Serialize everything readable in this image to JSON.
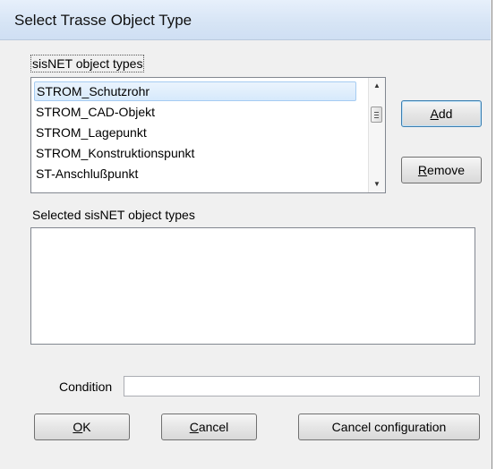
{
  "window": {
    "title": "Select Trasse Object Type"
  },
  "object_types": {
    "label": "sisNET object types",
    "items": [
      "STROM_Schutzrohr",
      "STROM_CAD-Objekt",
      "STROM_Lagepunkt",
      "STROM_Konstruktionspunkt",
      "ST-Anschlußpunkt"
    ],
    "selected_index": 0
  },
  "selected_types": {
    "label": "Selected sisNET object types",
    "items": []
  },
  "actions": {
    "add_prefix": "",
    "add_accel": "A",
    "add_suffix": "dd",
    "remove_prefix": "",
    "remove_accel": "R",
    "remove_suffix": "emove"
  },
  "condition": {
    "label": "Condition",
    "value": ""
  },
  "footer": {
    "ok_accel": "O",
    "ok_suffix": "K",
    "cancel_accel": "C",
    "cancel_suffix": "ancel",
    "cancel_config_label": "Cancel configuration"
  }
}
